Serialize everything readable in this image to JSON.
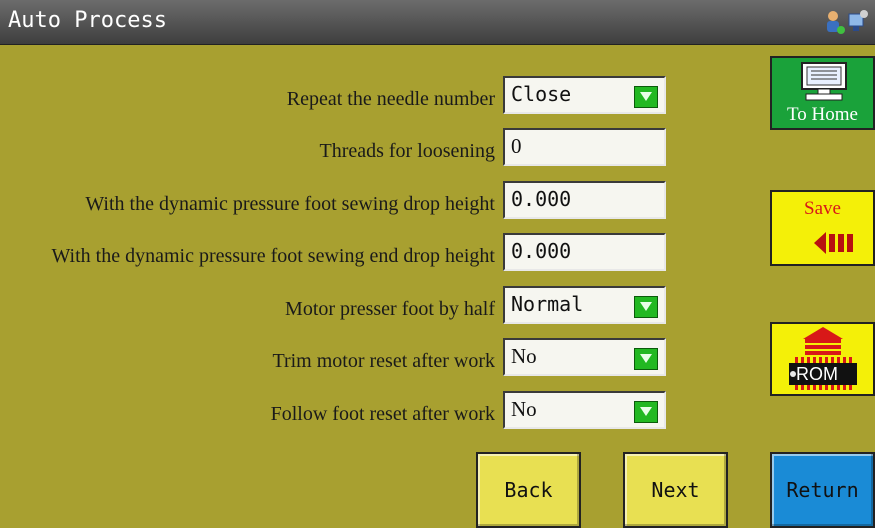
{
  "window": {
    "title": "Auto Process"
  },
  "settings": [
    {
      "label": "Repeat the needle number",
      "value": "Close",
      "has_dropdown": true
    },
    {
      "label": "Threads for loosening",
      "value": "0",
      "has_dropdown": false
    },
    {
      "label": "With the dynamic pressure foot sewing drop height",
      "value": "0.000",
      "has_dropdown": false
    },
    {
      "label": "With the dynamic pressure foot sewing end drop height",
      "value": "0.000",
      "has_dropdown": false
    },
    {
      "label": "Motor presser foot by half",
      "value": "Normal",
      "has_dropdown": true
    },
    {
      "label": "Trim motor reset after work",
      "value": "No",
      "has_dropdown": true
    },
    {
      "label": "Follow foot reset after work",
      "value": "No",
      "has_dropdown": true
    }
  ],
  "side_buttons": {
    "home_label": "To Home",
    "save_label": "Save",
    "rom_label": "ROM"
  },
  "nav": {
    "back_label": "Back",
    "next_label": "Next",
    "return_label": "Return"
  },
  "colors": {
    "background": "#a8a030",
    "titlebar": "#4e4e4e",
    "home_button": "#1aa23a",
    "save_button": "#f4f008",
    "return_button": "#1a8bd6",
    "nav_button": "#e8e052",
    "dropdown_button": "#22b822"
  },
  "icons": [
    "user-icon",
    "network-icon",
    "monitor-icon",
    "save-arrow-icon",
    "rom-chip-icon",
    "dropdown-arrow-icon"
  ]
}
